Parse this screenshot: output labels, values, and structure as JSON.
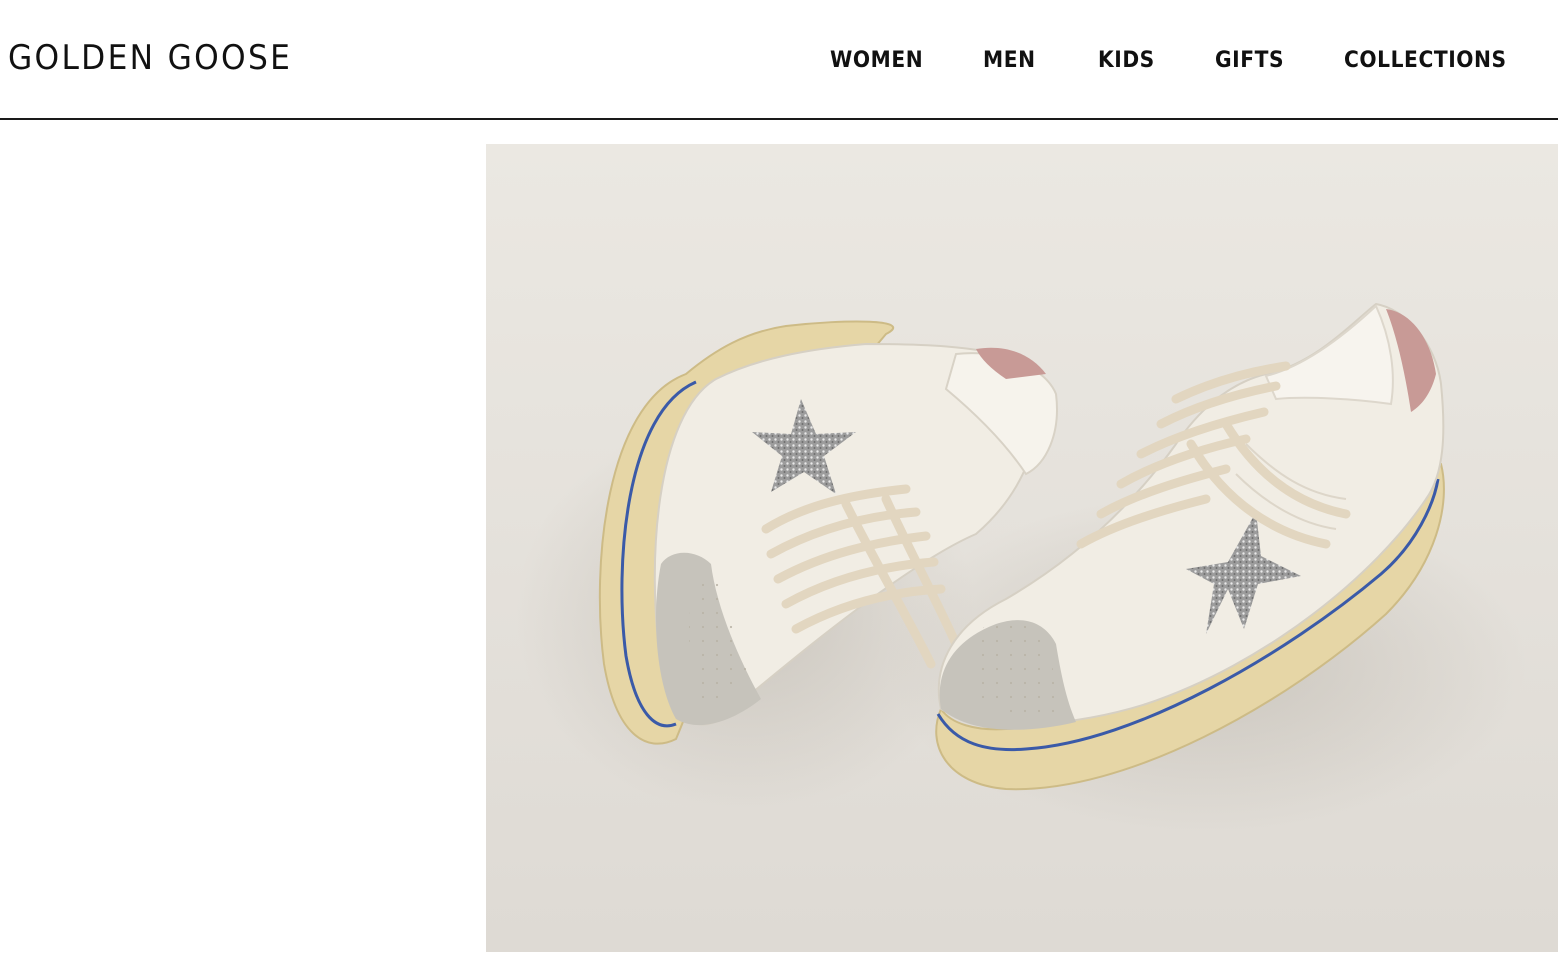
{
  "brand": {
    "logo_text": "GOLDEN GOOSE"
  },
  "nav": {
    "items": [
      {
        "label": "WOMEN"
      },
      {
        "label": "MEN"
      },
      {
        "label": "KIDS"
      },
      {
        "label": "GIFTS"
      },
      {
        "label": "COLLECTIONS"
      }
    ]
  },
  "hero": {
    "subject": "pair-of-sneakers",
    "colors": {
      "backdrop": "#e4e0da",
      "leather": "#f3efe6",
      "suede": "#c8c5bd",
      "sole": "#e8d9aa",
      "sole_stripe": "#3a5aa8",
      "heel_tab": "#c89a96",
      "star": "#a9a9a9",
      "laces": "#e2d6c0"
    }
  }
}
